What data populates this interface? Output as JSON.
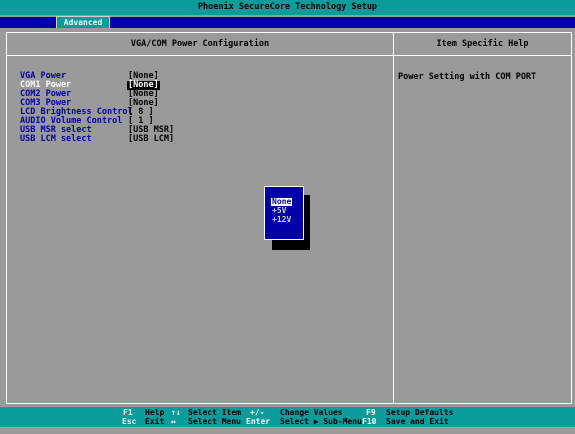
{
  "title": "Phoenix SecureCore Technology Setup",
  "tab": "Advanced",
  "menu_header": "VGA/COM Power Configuration",
  "help_header": "Item Specific Help",
  "help_text": "Power Setting with COM PORT",
  "items": [
    {
      "label": "VGA Power",
      "value": "[None]"
    },
    {
      "label": "COM1 Power",
      "value": "[None]"
    },
    {
      "label": "COM2 Power",
      "value": "[None]"
    },
    {
      "label": "COM3 Power",
      "value": "[None]"
    },
    {
      "label": "LCD Brightness Control",
      "value": "[ 8 ]"
    },
    {
      "label": "AUDIO Volume Control",
      "value": "[ 1 ]"
    },
    {
      "label": "USB MSR select",
      "value": "[USB MSR]"
    },
    {
      "label": "USB LCM select",
      "value": "[USB LCM]"
    }
  ],
  "selected_item": "COM1 Power",
  "popup_options": [
    "None",
    "+5V",
    "+12V"
  ],
  "popup_selected": "None",
  "keys": [
    {
      "key": "F1",
      "desc": "Help"
    },
    {
      "key": "Esc",
      "desc": "Exit"
    },
    {
      "key": "↑↓",
      "desc": "Select Item"
    },
    {
      "key": "↔",
      "desc": "Select Menu"
    },
    {
      "key": "+/-",
      "desc": "Change Values"
    },
    {
      "key": "Enter",
      "desc": "Select ▶ Sub-Menu"
    },
    {
      "key": "F9",
      "desc": "Setup Defaults"
    },
    {
      "key": "F10",
      "desc": "Save and Exit"
    }
  ],
  "colors": {
    "cyan": "#0a9b9b",
    "blue": "#0000a8",
    "gray": "#9a9a9a"
  }
}
